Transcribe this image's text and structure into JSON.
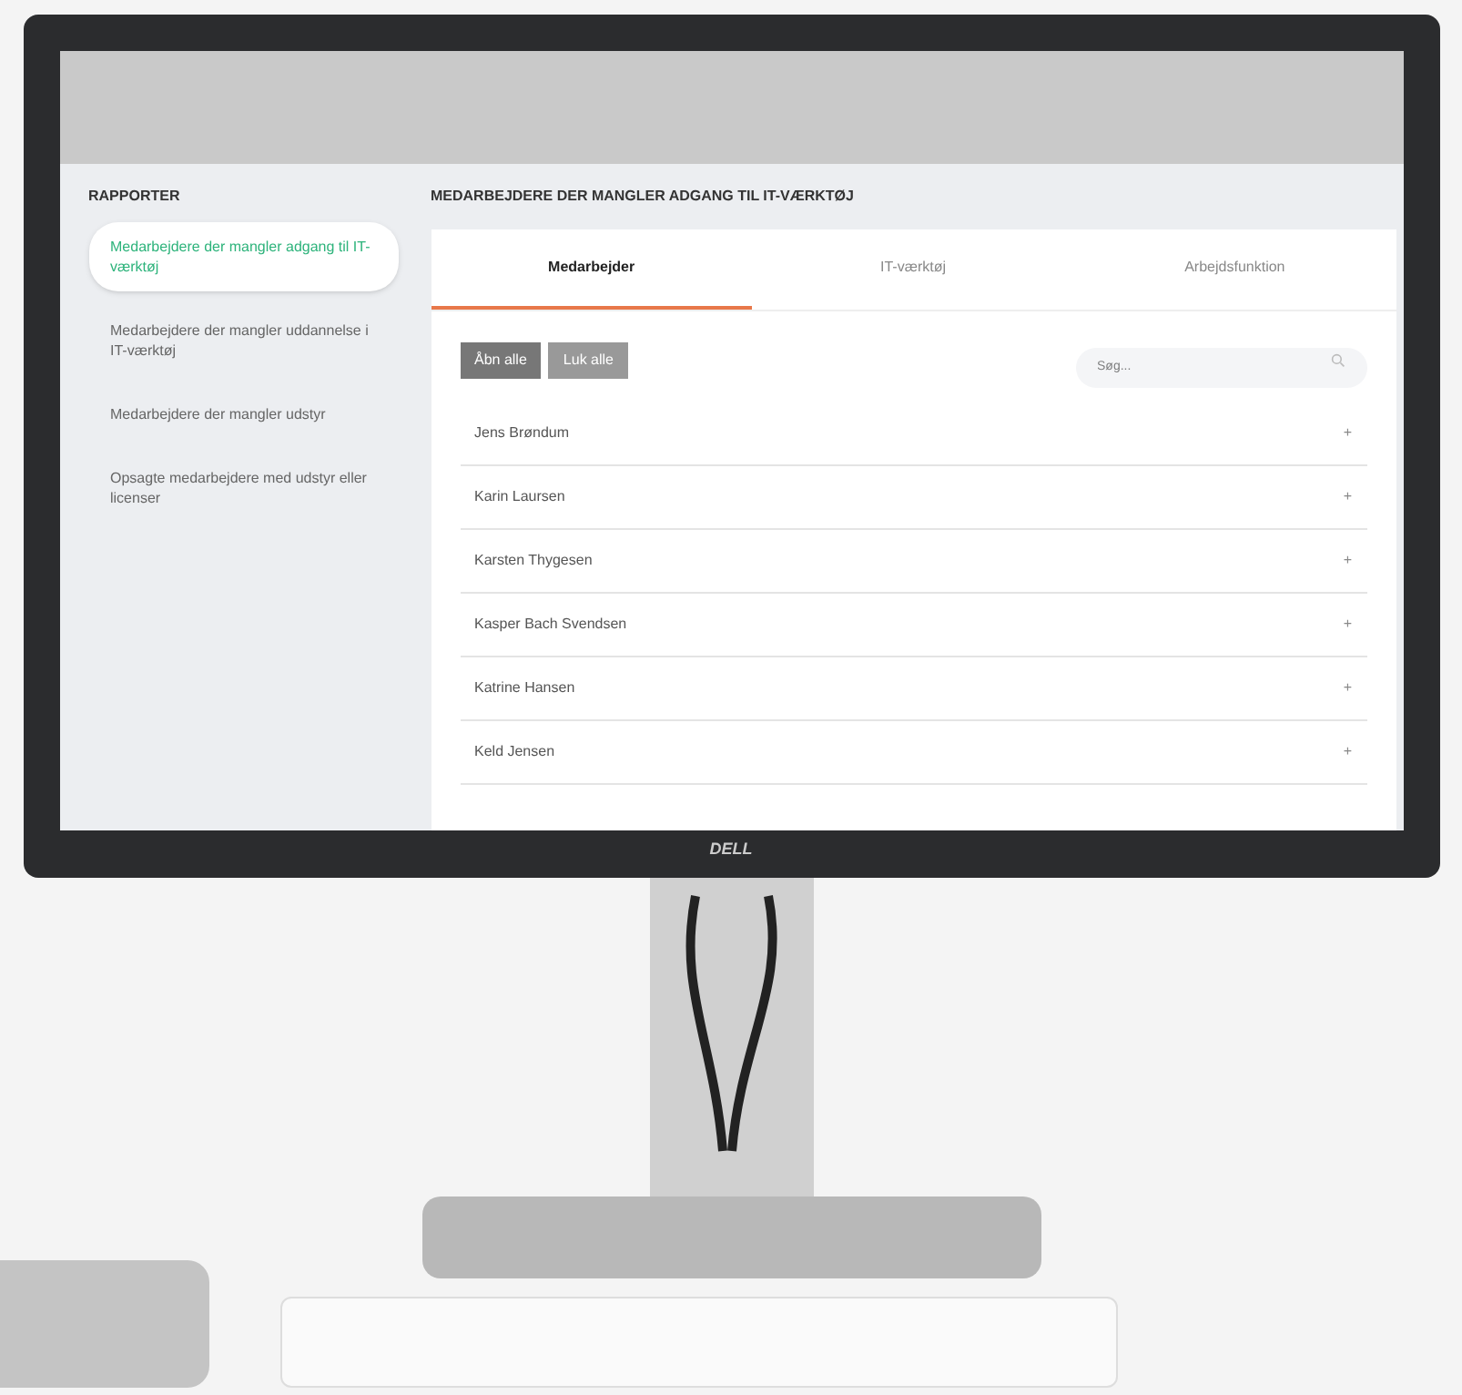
{
  "monitor": {
    "logo": "DELL"
  },
  "sidebar": {
    "heading": "RAPPORTER",
    "items": [
      {
        "label": "Medarbejdere der mangler adgang til IT-værktøj",
        "selected": true
      },
      {
        "label": "Medarbejdere der mangler uddannelse i IT-værktøj",
        "selected": false
      },
      {
        "label": "Medarbejdere der mangler udstyr",
        "selected": false
      },
      {
        "label": "Opsagte medarbejdere med udstyr eller licenser",
        "selected": false
      }
    ]
  },
  "main": {
    "heading": "MEDARBEJDERE DER MANGLER ADGANG TIL IT-VÆRKTØJ",
    "tabs": [
      {
        "label": "Medarbejder",
        "selected": true
      },
      {
        "label": "IT-værktøj",
        "selected": false
      },
      {
        "label": "Arbejdsfunktion",
        "selected": false
      }
    ],
    "buttons": [
      "Åbn alle",
      "Luk alle"
    ],
    "search": {
      "placeholder": "Søg..."
    },
    "rows": [
      {
        "name": "Jens Brøndum",
        "toggle": "+"
      },
      {
        "name": "Karin Laursen",
        "toggle": "+"
      },
      {
        "name": "Karsten Thygesen",
        "toggle": "+"
      },
      {
        "name": "Kasper Bach Svendsen",
        "toggle": "+"
      },
      {
        "name": "Katrine Hansen",
        "toggle": "+"
      },
      {
        "name": "Keld Jensen",
        "toggle": "+"
      }
    ]
  }
}
